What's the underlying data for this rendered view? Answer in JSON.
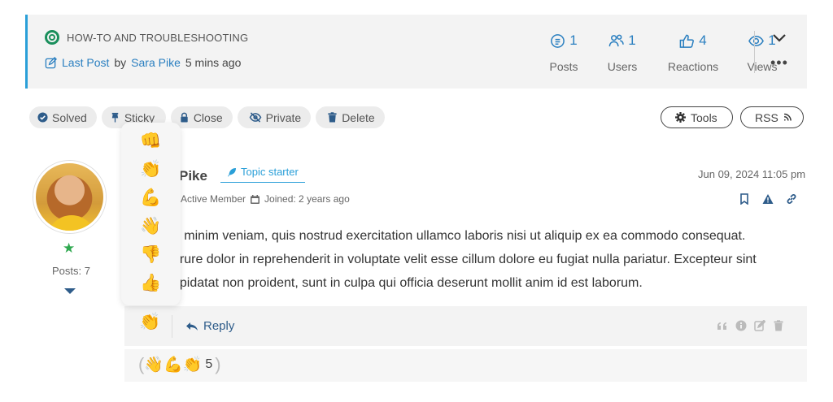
{
  "topic": {
    "category": "HOW-TO AND TROUBLESHOOTING",
    "last_post_label": "Last Post",
    "by": "by",
    "last_post_author": "Sara Pike",
    "last_post_time": "5 mins ago"
  },
  "stats": [
    {
      "value": "1",
      "label": "Posts",
      "icon": "posts-icon"
    },
    {
      "value": "1",
      "label": "Users",
      "icon": "users-icon"
    },
    {
      "value": "4",
      "label": "Reactions",
      "icon": "thumbs-up-icon"
    },
    {
      "value": "1",
      "label": "Views",
      "icon": "eye-icon"
    }
  ],
  "actions": {
    "solved": "Solved",
    "sticky": "Sticky",
    "close": "Close",
    "private": "Private",
    "delete": "Delete",
    "tools": "Tools",
    "rss": "RSS"
  },
  "author": {
    "name": "Pike",
    "badge": "Topic starter",
    "rank": "Active Member",
    "joined": "Joined: 2 years ago",
    "posts": "Posts: 7"
  },
  "post": {
    "date": "Jun 09, 2024 11:05 pm",
    "lines": [
      "ad minim veniam, quis nostrud exercitation ullamco laboris nisi ut aliquip ex ea commodo consequat.",
      "e irure dolor in reprehenderit in voluptate velit esse cillum dolore eu fugiat nulla pariatur. Excepteur sint",
      "cupidatat non proident, sunt in culpa qui officia deserunt mollit anim id est laborum."
    ],
    "reply_label": "Reply",
    "reaction_count": "5"
  },
  "reactions_popup": [
    "👊",
    "👏",
    "💪",
    "👋",
    "👎",
    "👍"
  ],
  "current_reaction": "👏",
  "reaction_summary": [
    "👋",
    "💪",
    "👏"
  ],
  "colors": {
    "accent": "#2a9fd8",
    "link": "#2a7fc0",
    "dark_blue": "#2e5c8a",
    "green": "#1a8f5c",
    "star": "#2fa84f"
  }
}
